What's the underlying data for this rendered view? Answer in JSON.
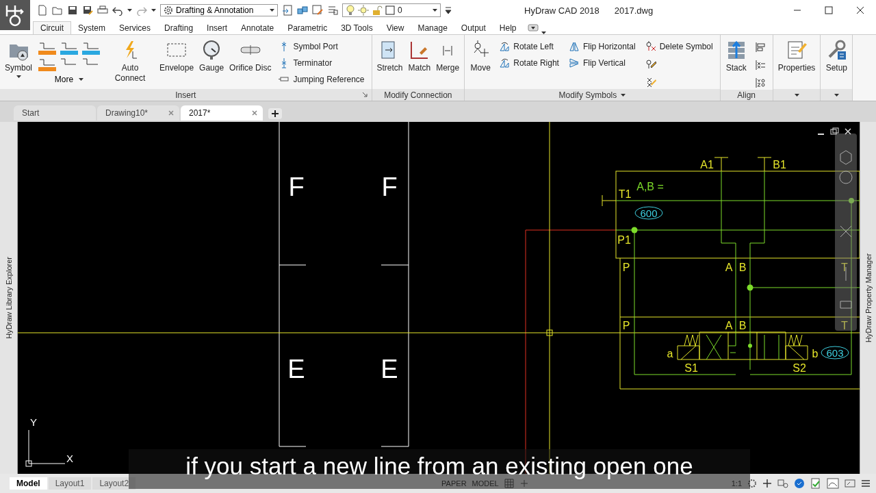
{
  "window": {
    "title": "HyDraw CAD 2018",
    "document": "2017.dwg"
  },
  "quick_access": {
    "workspace": "Drafting & Annotation",
    "layer": "0"
  },
  "ribbon_tabs": [
    {
      "label": "Circuit",
      "selected": true
    },
    {
      "label": "System",
      "selected": false
    },
    {
      "label": "Services",
      "selected": false
    },
    {
      "label": "Drafting",
      "selected": false
    },
    {
      "label": "Insert",
      "selected": false
    },
    {
      "label": "Annotate",
      "selected": false
    },
    {
      "label": "Parametric",
      "selected": false
    },
    {
      "label": "3D Tools",
      "selected": false
    },
    {
      "label": "View",
      "selected": false
    },
    {
      "label": "Manage",
      "selected": false
    },
    {
      "label": "Output",
      "selected": false
    },
    {
      "label": "Help",
      "selected": false
    }
  ],
  "ribbon_panels": [
    {
      "title": "Insert",
      "launcher": true,
      "groups": [
        {
          "kind": "large",
          "label": "Symbol",
          "dropdown": true
        },
        {
          "kind": "gallery",
          "label": "More",
          "dropdown": true
        },
        {
          "kind": "large",
          "label": "Auto Connect"
        },
        {
          "kind": "large",
          "label": "Envelope"
        },
        {
          "kind": "large",
          "label": "Gauge"
        },
        {
          "kind": "large",
          "label": "Orifice Disc"
        },
        {
          "kind": "column",
          "items": [
            {
              "label": "Symbol Port"
            },
            {
              "label": "Terminator"
            },
            {
              "label": "Jumping Reference"
            }
          ]
        }
      ]
    },
    {
      "title": "Modify Connection",
      "groups": [
        {
          "kind": "large",
          "label": "Stretch"
        },
        {
          "kind": "large",
          "label": "Match"
        },
        {
          "kind": "large",
          "label": "Merge"
        }
      ]
    },
    {
      "title": "Modify Symbols",
      "dropdown": true,
      "groups": [
        {
          "kind": "large",
          "label": "Move"
        },
        {
          "kind": "column",
          "items": [
            {
              "label": "Rotate Left"
            },
            {
              "label": "Rotate Right"
            }
          ]
        },
        {
          "kind": "column",
          "items": [
            {
              "label": "Flip Horizontal"
            },
            {
              "label": "Flip Vertical"
            }
          ]
        },
        {
          "kind": "column",
          "items": [
            {
              "kind": "labeled",
              "label": "Delete Symbol"
            },
            {
              "kind": "icon"
            },
            {
              "kind": "icon"
            }
          ]
        }
      ]
    },
    {
      "title": "Align",
      "groups": [
        {
          "kind": "large",
          "label": "Stack"
        },
        {
          "kind": "column",
          "items": [
            {
              "kind": "icon"
            },
            {
              "kind": "icon"
            },
            {
              "kind": "icon"
            }
          ]
        }
      ]
    },
    {
      "dropdown": true,
      "groups": [
        {
          "kind": "large",
          "label": "Properties"
        }
      ]
    },
    {
      "dropdown": true,
      "groups": [
        {
          "kind": "large",
          "label": "Setup"
        }
      ]
    }
  ],
  "document_tabs": [
    {
      "label": "Start",
      "selected": false,
      "closable": false
    },
    {
      "label": "Drawing10*",
      "selected": false,
      "closable": true
    },
    {
      "label": "2017*",
      "selected": true,
      "closable": true
    }
  ],
  "side_panels": {
    "left": "HyDraw Library Explorer",
    "right": "HyDraw Property Manager"
  },
  "drawing": {
    "frame_labels": [
      "F",
      "F",
      "E",
      "E"
    ],
    "ports_top": [
      "A1",
      "B1"
    ],
    "ports_side": [
      "T1",
      "P1"
    ],
    "formula": "A,B =",
    "tags": [
      "600",
      "603"
    ],
    "plate_labels": [
      [
        "P",
        "A",
        "B",
        "T"
      ],
      [
        "P",
        "A",
        "B",
        "T"
      ]
    ],
    "valve_labels": [
      "a",
      "b",
      "S1",
      "S2"
    ],
    "axes": [
      "Y",
      "X"
    ]
  },
  "layout_tabs": [
    {
      "label": "Model",
      "selected": true
    },
    {
      "label": "Layout1",
      "selected": false
    },
    {
      "label": "Layout2",
      "selected": false
    }
  ],
  "status_bar": {
    "space": [
      "PAPER",
      "MODEL"
    ],
    "scale": "1:1"
  },
  "subtitle": "if you start a new line from an existing open one"
}
